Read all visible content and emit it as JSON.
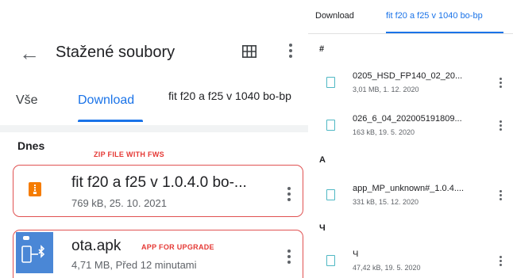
{
  "left": {
    "title": "Stažené soubory",
    "tabs": [
      "Vše",
      "Download",
      "fit f20 a f25 v 1040 bo-bp"
    ],
    "section": "Dnes",
    "files": [
      {
        "name": "fit f20 a f25 v 1.0.4.0 bo-...",
        "meta": "769 kB, 25. 10. 2021",
        "annotation": "ZIP FILE WITH FWS",
        "icon": "zip-icon"
      },
      {
        "name": "ota.apk",
        "meta": "4,71 MB, Před 12 minutami",
        "annotation": "APP FOR UPGRADE",
        "icon": "android-bluetooth-icon"
      }
    ]
  },
  "right": {
    "tabs": [
      "Download",
      "fit f20 a f25 v 1040 bo-bp"
    ],
    "sections": [
      {
        "label": "#",
        "files": [
          {
            "name": "0205_HSD_FP140_02_20...",
            "meta": "3,01 MB, 1. 12. 2020"
          },
          {
            "name": "026_6_04_202005191809...",
            "meta": "163 kB, 19. 5. 2020"
          }
        ]
      },
      {
        "label": "A",
        "files": [
          {
            "name": "app_MP_unknown#_1.0.4....",
            "meta": "331 kB, 15. 12. 2020"
          }
        ]
      },
      {
        "label": "Ч",
        "files": [
          {
            "name": "Ч",
            "meta": "47,42 kB, 19. 5. 2020"
          }
        ]
      }
    ]
  },
  "colors": {
    "accent": "#1a73e8",
    "annotation": "#e53935",
    "zip": "#f57c00",
    "apk": "#4a87d6",
    "doc": "#4fb8c4"
  }
}
